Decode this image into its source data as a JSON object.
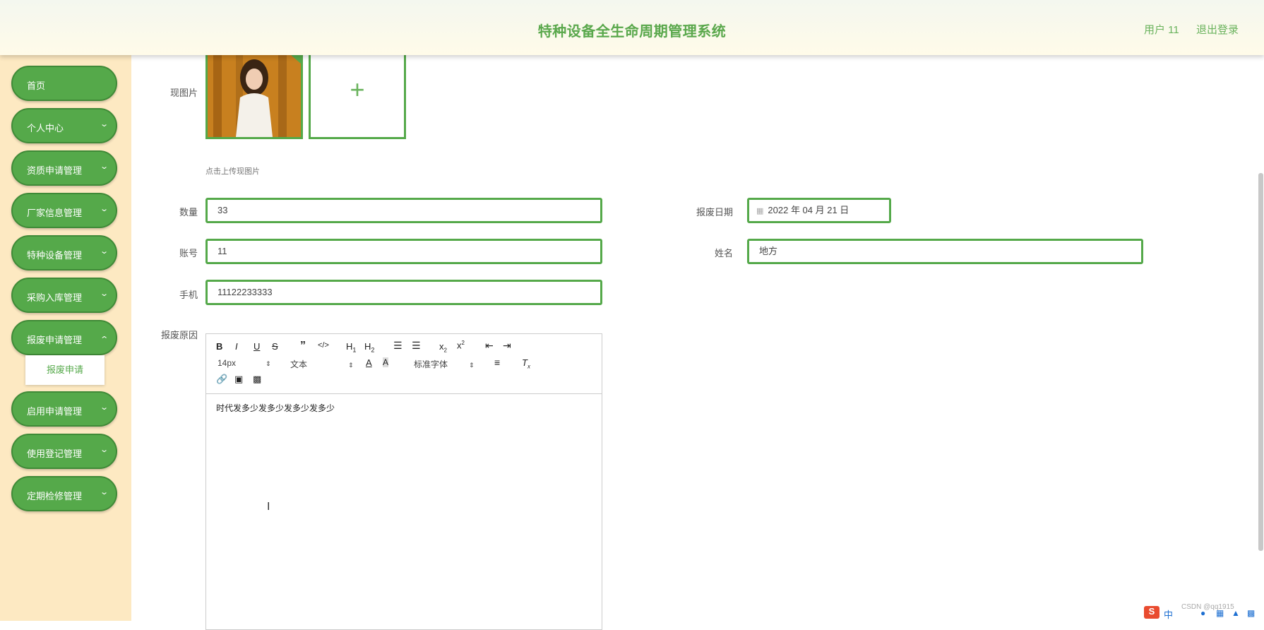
{
  "header": {
    "title": "特种设备全生命周期管理系统",
    "user": "用户 11",
    "logout": "退出登录"
  },
  "sidebar": {
    "items": [
      {
        "label": "首页",
        "chevron": false
      },
      {
        "label": "个人中心",
        "chevron": true
      },
      {
        "label": "资质申请管理",
        "chevron": true
      },
      {
        "label": "厂家信息管理",
        "chevron": true
      },
      {
        "label": "特种设备管理",
        "chevron": true
      },
      {
        "label": "采购入库管理",
        "chevron": true
      },
      {
        "label": "报废申请管理",
        "chevron": true
      },
      {
        "label": "启用申请管理",
        "chevron": true
      },
      {
        "label": "使用登记管理",
        "chevron": true
      },
      {
        "label": "定期检修管理",
        "chevron": true
      }
    ],
    "submenu": "报废申请"
  },
  "form": {
    "image_label": "现图片",
    "upload_hint": "点击上传现图片",
    "quantity_label": "数量",
    "quantity_value": "33",
    "date_label": "报废日期",
    "date_value": "2022 年 04 月 21 日",
    "account_label": "账号",
    "account_value": "11",
    "name_label": "姓名",
    "name_value": "地方",
    "phone_label": "手机",
    "phone_value": "11122233333",
    "reason_label": "报废原因"
  },
  "editor": {
    "font_size": "14px",
    "block_type": "文本",
    "font_family": "标准字体",
    "content": "时代发多少发多少发多少发多少"
  },
  "tray": {
    "watermark": "CSDN @qq1915"
  }
}
